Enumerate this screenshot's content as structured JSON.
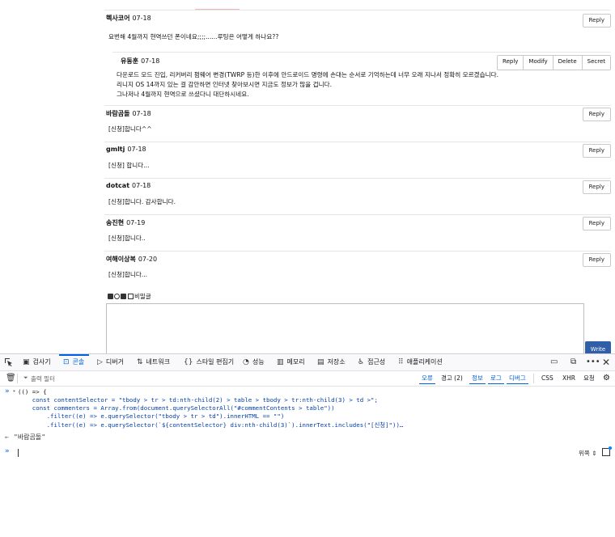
{
  "comments": [
    {
      "author": "헥사코어",
      "date": "07-18",
      "reply_label": "Reply",
      "body": [
        "요번해 4월까지 현역쓰던 폰이네요;;;;......루팅은 어떻게 하나요??"
      ],
      "reply": {
        "author": "유동훈",
        "date": "07-18",
        "actions": [
          "Reply",
          "Modify",
          "Delete",
          "Secret"
        ],
        "body": [
          "다운로드 모드 진입, 리커버리 펌웨어 변경(TWRP 등)한 이후에 안드로이드 명령에 손대는 순서로 기억하는데 너무 오래 지나서 정확히 모르겠습니다.",
          "리니지 OS 14까지 있는 걸 감안하면 인터넷 찾아보시면 지금도 정보가 많을 겁니다.",
          "그나저나 4월까지 현역으로 쓰셨다니 대단하시네요."
        ]
      }
    },
    {
      "author": "바람곰돌",
      "date": "07-18",
      "reply_label": "Reply",
      "body": [
        "[신청]합니다^^"
      ]
    },
    {
      "author": "gmltj",
      "date": "07-18",
      "reply_label": "Reply",
      "body": [
        "[신청] 합니다..."
      ]
    },
    {
      "author": "dotcat",
      "date": "07-18",
      "reply_label": "Reply",
      "body": [
        "[신청]합니다. 감사합니다."
      ]
    },
    {
      "author": "송진현",
      "date": "07-19",
      "reply_label": "Reply",
      "body": [
        "[신청]합니다.."
      ]
    },
    {
      "author": "여해이상복",
      "date": "07-20",
      "reply_label": "Reply",
      "body": [
        "[신청]합니다..."
      ]
    }
  ],
  "editor": {
    "secret_label": "비밀글",
    "write_label": "Write"
  },
  "devtools": {
    "tabs": [
      {
        "label": "검사기",
        "icon": "inspector-icon"
      },
      {
        "label": "콘솔",
        "icon": "console-icon",
        "active": true
      },
      {
        "label": "디버거",
        "icon": "debugger-icon"
      },
      {
        "label": "네트워크",
        "icon": "network-icon"
      },
      {
        "label": "스타일 편집기",
        "icon": "style-editor-icon"
      },
      {
        "label": "성능",
        "icon": "performance-icon"
      },
      {
        "label": "메모리",
        "icon": "memory-icon"
      },
      {
        "label": "저장소",
        "icon": "storage-icon"
      },
      {
        "label": "접근성",
        "icon": "accessibility-icon"
      },
      {
        "label": "애플리케이션",
        "icon": "application-icon"
      }
    ],
    "filter_placeholder": "출력 필터",
    "levels": {
      "errors": "오류",
      "warnings": "경고 (2)",
      "info": "정보",
      "logs": "로그",
      "debug": "디버그",
      "css": "CSS",
      "xhr": "XHR",
      "requests": "요청"
    },
    "console": {
      "code": [
        "(() => {",
        "    const contentSelector = \"tbody > tr > td:nth-child(2) > table > tbody > tr:nth-child(3) > td >\";",
        "    const commenters = Array.from(document.querySelectorAll(\"#commentContents > table\"))",
        "        .filter((e) => e.querySelector(\"tbody > tr > td\").innerHTML == \"\")",
        "        .filter((e) => e.querySelector(`${contentSelector} div:nth-child(3)`).innerText.includes(\"[신청]\"))…"
      ],
      "result": "\"바람곰돌\"",
      "position_label": "위쪽"
    },
    "colors": {
      "accent": "#0061e0",
      "write_button": "#2f5fa6"
    }
  }
}
